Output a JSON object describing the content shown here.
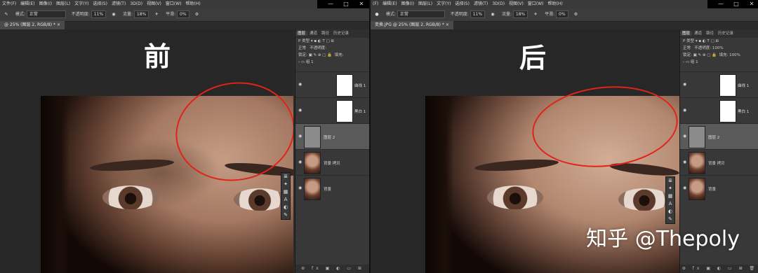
{
  "left": {
    "menu": [
      "文件(F)",
      "编辑(E)",
      "图像(I)",
      "图层(L)",
      "文字(Y)",
      "选择(S)",
      "滤镜(T)",
      "3D(D)",
      "视图(V)",
      "窗口(W)",
      "帮助(H)"
    ],
    "options": {
      "mode_label": "模式:",
      "mode_value": "正常",
      "opacity_label": "不透明度:",
      "opacity_value": "11%",
      "flow_label": "流量:",
      "flow_value": "18%",
      "smooth_label": "平滑:",
      "smooth_value": "0%"
    },
    "doc_tab": "@ 25% (图层 2, RGB/8) *",
    "canvas_label": "前",
    "panel_tabs": [
      "图层",
      "通道",
      "路径",
      "历史记录"
    ],
    "layers": {
      "filter_label": "P 类型",
      "blend_label": "正常",
      "opacity_label": "不透明度:",
      "lock_label": "锁定:",
      "fill_label": "填充:",
      "group_name": "组 1",
      "items": [
        {
          "name": "曲线 1",
          "thumb": "white"
        },
        {
          "name": "黑白 1",
          "thumb": "white"
        },
        {
          "name": "图层 2",
          "thumb": "gray"
        },
        {
          "name": "背景 拷贝",
          "thumb": "face"
        },
        {
          "name": "背景",
          "thumb": "face"
        }
      ]
    }
  },
  "right": {
    "menu": [
      "(F)",
      "编辑(E)",
      "图像(I)",
      "图层(L)",
      "文字(Y)",
      "选择(S)",
      "滤镜(T)",
      "3D(D)",
      "视图(V)",
      "窗口(W)",
      "帮助(H)"
    ],
    "options": {
      "mode_label": "模式:",
      "mode_value": "正常",
      "opacity_label": "不透明度:",
      "opacity_value": "11%",
      "flow_label": "流量:",
      "flow_value": "18%",
      "smooth_label": "平滑:",
      "smooth_value": "0%"
    },
    "doc_tab": "变换.JPG @ 25% (图层 2, RGB/8) *",
    "canvas_label": "后",
    "panel_tabs": [
      "图层",
      "通道",
      "路径",
      "历史记录"
    ],
    "layers": {
      "filter_label": "P 类型",
      "blend_label": "正常",
      "opacity_label": "不透明度:",
      "opacity_value": "100%",
      "lock_label": "锁定:",
      "fill_label": "填充:",
      "fill_value": "100%",
      "group_name": "组 1",
      "items": [
        {
          "name": "曲线 1",
          "thumb": "white"
        },
        {
          "name": "黑白 1",
          "thumb": "white"
        },
        {
          "name": "图层 2",
          "thumb": "gray"
        },
        {
          "name": "背景 拷贝",
          "thumb": "face"
        },
        {
          "name": "背景",
          "thumb": "face"
        }
      ]
    }
  },
  "watermark": "知乎 @Thepoly",
  "colors": {
    "highlight_circle": "#e2231a"
  }
}
